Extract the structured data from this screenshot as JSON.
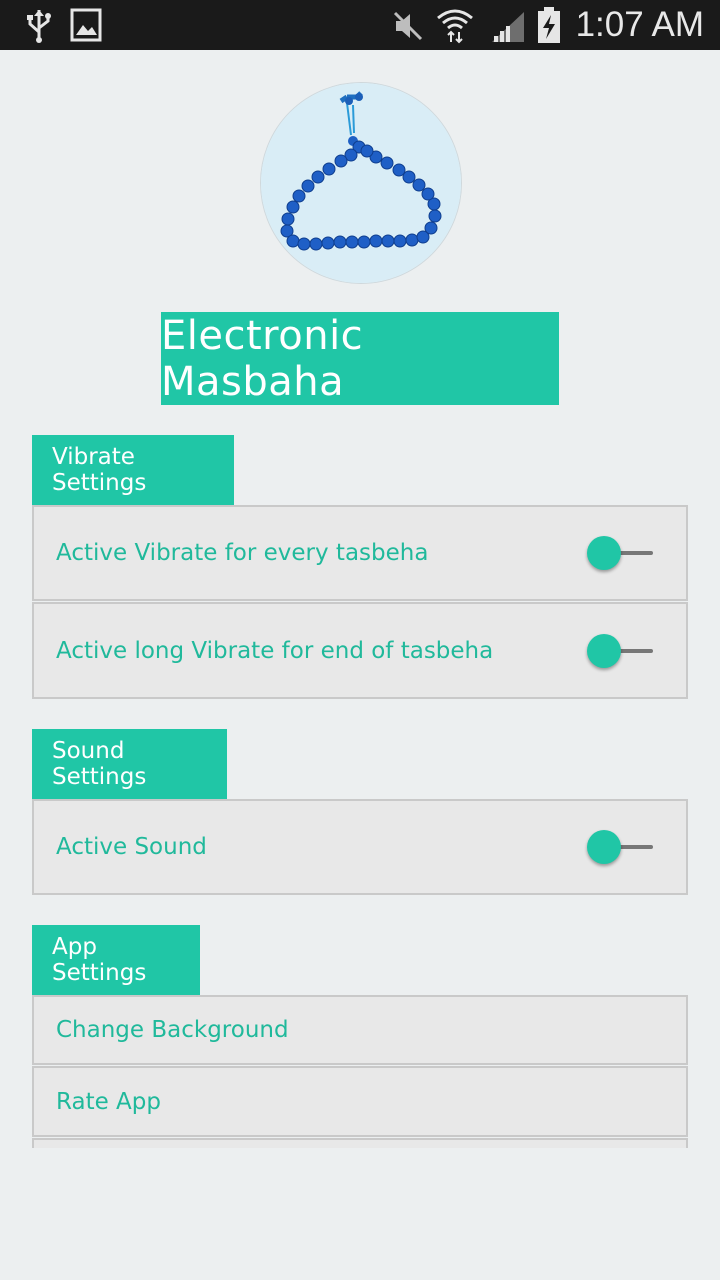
{
  "status_bar": {
    "time": "1:07 AM",
    "icons": [
      "usb-icon",
      "image-icon",
      "mute-icon",
      "wifi-icon",
      "signal-icon",
      "battery-icon"
    ]
  },
  "app": {
    "title": "Electronic Masbaha",
    "accent_color": "#20c6a6"
  },
  "sections": {
    "vibrate": {
      "header": "Vibrate Settings",
      "items": [
        {
          "label": "Active Vibrate for every tasbeha",
          "toggle": "off"
        },
        {
          "label": "Active long Vibrate for end of tasbeha",
          "toggle": "off"
        }
      ]
    },
    "sound": {
      "header": "Sound Settings",
      "items": [
        {
          "label": "Active Sound",
          "toggle": "off"
        }
      ]
    },
    "app": {
      "header": "App Settings",
      "items": [
        {
          "label": "Change Background"
        },
        {
          "label": "Rate App"
        }
      ]
    }
  }
}
